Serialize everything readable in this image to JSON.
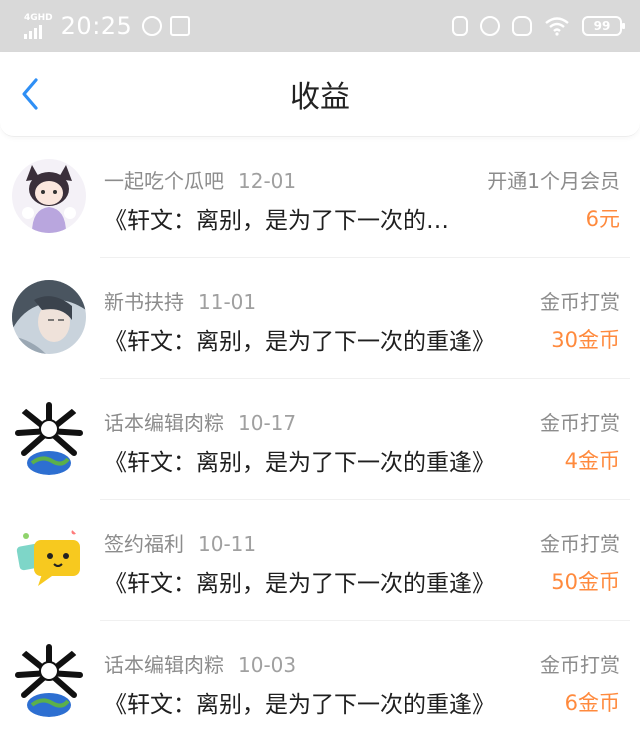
{
  "status_bar": {
    "network": "4GHD",
    "time": "20:25",
    "battery": "99"
  },
  "header": {
    "title": "收益"
  },
  "colors": {
    "accent_blue": "#2f8ff5",
    "amount_orange": "#ff8a3d"
  },
  "items": [
    {
      "source": "一起吃个瓜吧",
      "date": "12-01",
      "type": "开通1个月会员",
      "work": "《轩文：离别，是为了下一次的…",
      "amount": "6元",
      "avatar_icon": "anime-cat-girl-avatar"
    },
    {
      "source": "新书扶持",
      "date": "11-01",
      "type": "金币打赏",
      "work": "《轩文：离别，是为了下一次的重逢》",
      "amount": "30金币",
      "avatar_icon": "anime-portrait-avatar"
    },
    {
      "source": "话本编辑肉粽",
      "date": "10-17",
      "type": "金币打赏",
      "work": "《轩文：离别，是为了下一次的重逢》",
      "amount": "4金币",
      "avatar_icon": "globe-bones-avatar"
    },
    {
      "source": "签约福利",
      "date": "10-11",
      "type": "金币打赏",
      "work": "《轩文：离别，是为了下一次的重逢》",
      "amount": "50金币",
      "avatar_icon": "yellow-chat-bubble-avatar"
    },
    {
      "source": "话本编辑肉粽",
      "date": "10-03",
      "type": "金币打赏",
      "work": "《轩文：离别，是为了下一次的重逢》",
      "amount": "6金币",
      "avatar_icon": "globe-bones-avatar"
    }
  ]
}
